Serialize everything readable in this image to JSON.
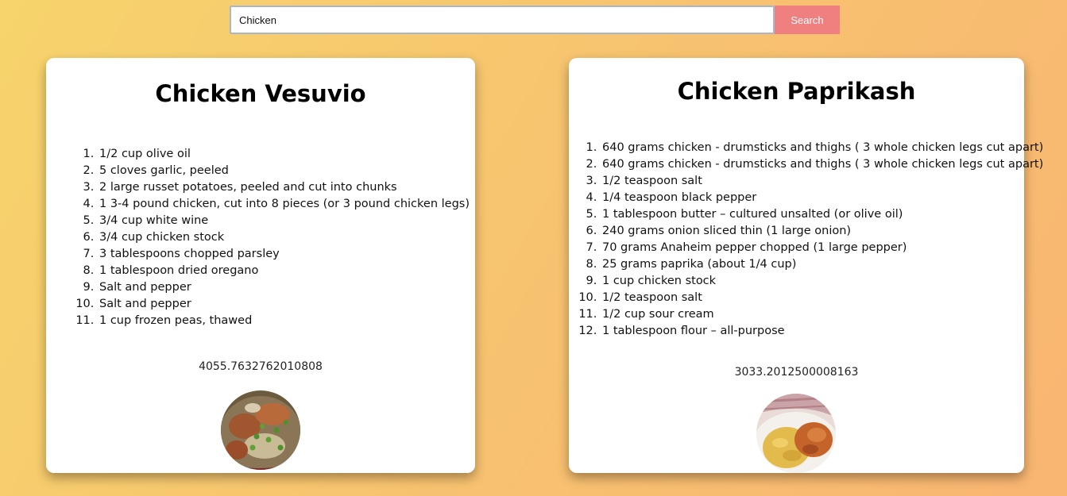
{
  "search": {
    "value": "Chicken",
    "button_label": "Search"
  },
  "recipes": [
    {
      "title": "Chicken Vesuvio",
      "ingredients": [
        "1/2 cup olive oil",
        "5 cloves garlic, peeled",
        "2 large russet potatoes, peeled and cut into chunks",
        "1 3-4 pound chicken, cut into 8 pieces (or 3 pound chicken legs)",
        "3/4 cup white wine",
        "3/4 cup chicken stock",
        "3 tablespoons chopped parsley",
        "1 tablespoon dried oregano",
        "Salt and pepper",
        "Salt and pepper",
        "1 cup frozen peas, thawed"
      ],
      "calories": "4055.7632762010808"
    },
    {
      "title": "Chicken Paprikash",
      "ingredients": [
        "640 grams chicken - drumsticks and thighs ( 3 whole chicken legs cut apart)",
        "640 grams chicken - drumsticks and thighs ( 3 whole chicken legs cut apart)",
        "1/2 teaspoon salt",
        "1/4 teaspoon black pepper",
        "1 tablespoon butter – cultured unsalted (or olive oil)",
        "240 grams onion sliced thin (1 large onion)",
        "70 grams Anaheim pepper chopped (1 large pepper)",
        "25 grams paprika (about 1/4 cup)",
        "1 cup chicken stock",
        "1/2 teaspoon salt",
        "1/2 cup sour cream",
        "1 tablespoon flour – all-purpose"
      ],
      "calories": "3033.2012500008163"
    }
  ]
}
